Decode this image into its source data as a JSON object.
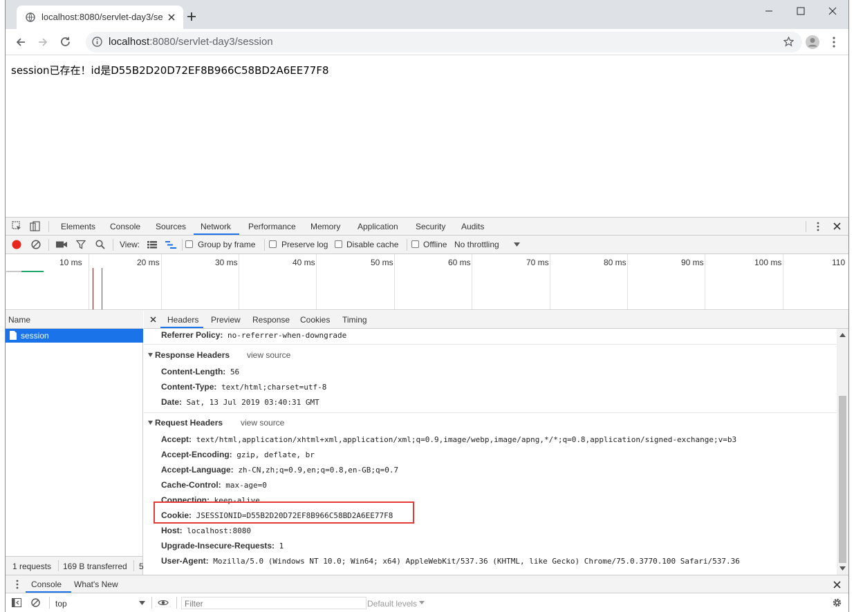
{
  "browser": {
    "tab_title": "localhost:8080/servlet-day3/se",
    "url_host": "localhost",
    "url_path": ":8080/servlet-day3/session"
  },
  "page": {
    "text": "session已存在！id是D55B2D20D72EF8B966C58BD2A6EE77F8"
  },
  "devtools": {
    "tabs": [
      "Elements",
      "Console",
      "Sources",
      "Network",
      "Performance",
      "Memory",
      "Application",
      "Security",
      "Audits"
    ],
    "active_tab": "Network"
  },
  "network_toolbar": {
    "view_label": "View:",
    "group_by_frame": "Group by frame",
    "preserve_log": "Preserve log",
    "disable_cache": "Disable cache",
    "offline": "Offline",
    "throttling": "No throttling"
  },
  "overview": {
    "ticks": [
      "10 ms",
      "20 ms",
      "30 ms",
      "40 ms",
      "50 ms",
      "60 ms",
      "70 ms",
      "80 ms",
      "90 ms",
      "100 ms",
      "110"
    ]
  },
  "requests": {
    "name_header": "Name",
    "items": [
      "session"
    ],
    "summary_count": "1 requests",
    "summary_transferred": "169 B transferred",
    "summary_cut": "5"
  },
  "detail": {
    "tabs": [
      "Headers",
      "Preview",
      "Response",
      "Cookies",
      "Timing"
    ],
    "active_tab": "Headers",
    "referrer_key": "Referrer Policy:",
    "referrer_value": "no-referrer-when-downgrade",
    "response_title": "Response Headers",
    "request_title": "Request Headers",
    "view_source": "view source",
    "response_headers": [
      {
        "key": "Content-Length:",
        "value": "56"
      },
      {
        "key": "Content-Type:",
        "value": "text/html;charset=utf-8"
      },
      {
        "key": "Date:",
        "value": "Sat, 13 Jul 2019 03:40:31 GMT"
      }
    ],
    "request_headers": [
      {
        "key": "Accept:",
        "value": "text/html,application/xhtml+xml,application/xml;q=0.9,image/webp,image/apng,*/*;q=0.8,application/signed-exchange;v=b3"
      },
      {
        "key": "Accept-Encoding:",
        "value": "gzip, deflate, br"
      },
      {
        "key": "Accept-Language:",
        "value": "zh-CN,zh;q=0.9,en;q=0.8,en-GB;q=0.7"
      },
      {
        "key": "Cache-Control:",
        "value": "max-age=0"
      },
      {
        "key": "Connection:",
        "value": "keep-alive"
      },
      {
        "key": "Cookie:",
        "value": "JSESSIONID=D55B2D20D72EF8B966C58BD2A6EE77F8"
      },
      {
        "key": "Host:",
        "value": "localhost:8080"
      },
      {
        "key": "Upgrade-Insecure-Requests:",
        "value": "1"
      },
      {
        "key": "User-Agent:",
        "value": "Mozilla/5.0 (Windows NT 10.0; Win64; x64) AppleWebKit/537.36 (KHTML, like Gecko) Chrome/75.0.3770.100 Safari/537.36"
      }
    ]
  },
  "drawer": {
    "tabs": [
      "Console",
      "What's New"
    ],
    "context": "top",
    "filter_placeholder": "Filter",
    "levels": "Default levels"
  },
  "colors": {
    "accent": "#1a73e8",
    "highlight_box": "#e53935",
    "record": "#e8261e"
  }
}
